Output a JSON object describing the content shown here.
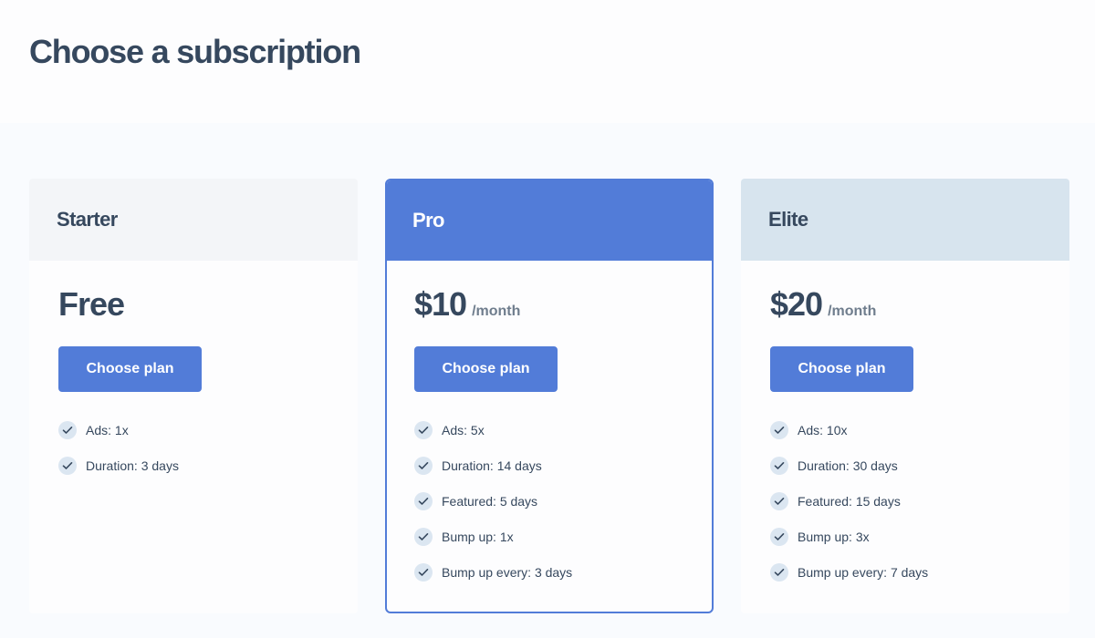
{
  "page": {
    "title": "Choose a subscription"
  },
  "colors": {
    "accent": "#527cd8",
    "text": "#36485e",
    "starter_header": "#f3f5f8",
    "elite_header": "#d7e4ee",
    "check_bg": "#dbe6f1"
  },
  "plans": [
    {
      "name": "Starter",
      "price": "Free",
      "period": "",
      "button_label": "Choose plan",
      "features": [
        "Ads: 1x",
        "Duration: 3 days"
      ]
    },
    {
      "name": "Pro",
      "price": "$10",
      "period": "/month",
      "button_label": "Choose plan",
      "features": [
        "Ads: 5x",
        "Duration: 14 days",
        "Featured: 5 days",
        "Bump up: 1x",
        "Bump up every: 3 days"
      ]
    },
    {
      "name": "Elite",
      "price": "$20",
      "period": "/month",
      "button_label": "Choose plan",
      "features": [
        "Ads: 10x",
        "Duration: 30 days",
        "Featured: 15 days",
        "Bump up: 3x",
        "Bump up every: 7 days"
      ]
    }
  ],
  "icons": {
    "feature": "check-icon"
  }
}
